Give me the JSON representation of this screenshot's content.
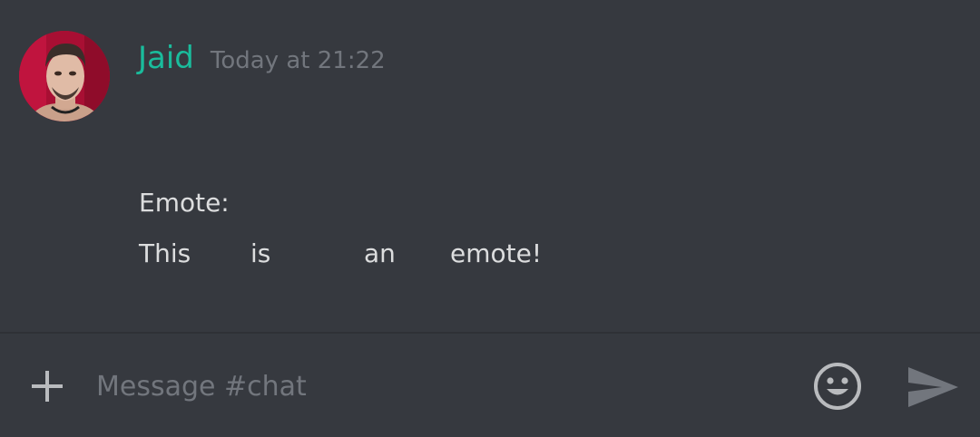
{
  "message": {
    "author": "Jaid",
    "timestamp": "Today at 21:22",
    "author_color": "#1abc9c",
    "lines": {
      "first": "Emote:",
      "words": [
        "This",
        "is",
        "an",
        "emote!"
      ]
    }
  },
  "composer": {
    "placeholder": "Message #chat",
    "add_icon": "plus-icon",
    "emoji_icon": "smiley-icon",
    "send_icon": "send-icon"
  },
  "colors": {
    "background": "#36393f",
    "text": "#dcddde",
    "muted": "#72767d"
  }
}
